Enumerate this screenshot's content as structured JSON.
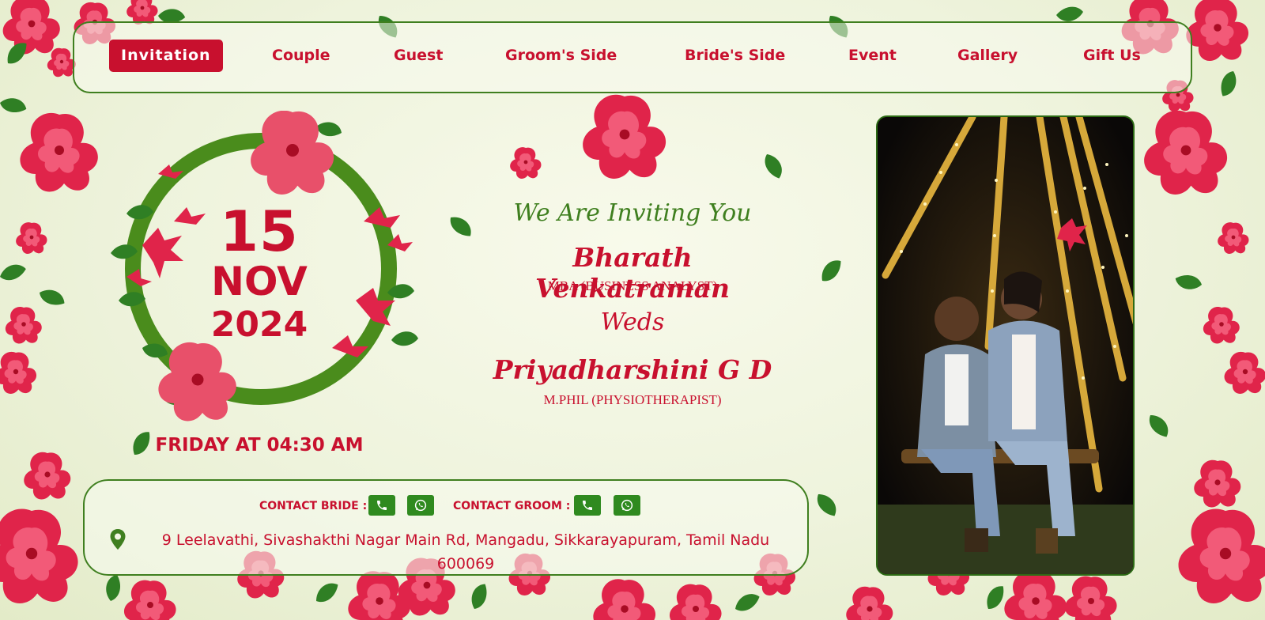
{
  "nav": {
    "items": [
      {
        "label": "Invitation",
        "active": true
      },
      {
        "label": "Couple"
      },
      {
        "label": "Guest"
      },
      {
        "label": "Groom's Side"
      },
      {
        "label": "Bride's Side"
      },
      {
        "label": "Event"
      },
      {
        "label": "Gallery"
      },
      {
        "label": "Gift Us"
      }
    ]
  },
  "date": {
    "day": "15",
    "month": "NOV",
    "year": "2024",
    "time": "FRIDAY AT 04:30 AM"
  },
  "invitation": {
    "heading": "We Are Inviting You",
    "groom_name": "Bharath Venkatraman",
    "groom_qualification": "MBA (BUSINESS ANALYST)",
    "weds": "Weds",
    "bride_name": "Priyadharshini G D",
    "bride_qualification": "M.PHIL (PHYSIOTHERAPIST)"
  },
  "contact": {
    "bride_label": "CONTACT BRIDE :",
    "groom_label": "CONTACT GROOM :",
    "address": "9 Leelavathi, Sivashakthi Nagar Main Rd, Mangadu, Sikkarayapuram, Tamil Nadu 600069"
  },
  "colors": {
    "primary_red": "#c8102e",
    "leaf_green": "#3f7f1f",
    "background": "#f3f6e4"
  },
  "icons": [
    "phone-icon",
    "whatsapp-icon",
    "location-pin-icon"
  ]
}
